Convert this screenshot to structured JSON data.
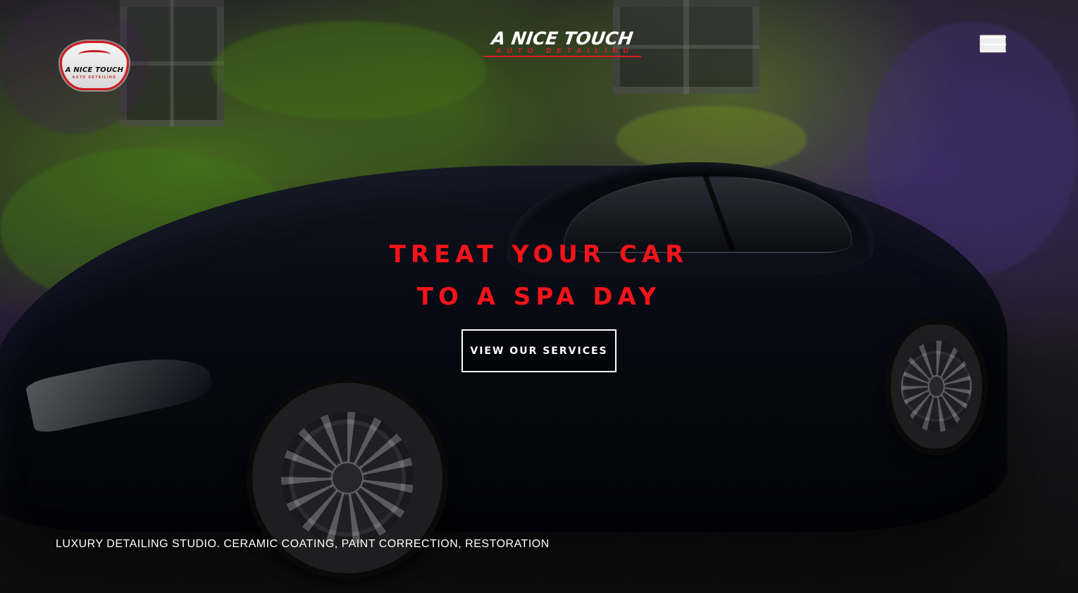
{
  "brand": {
    "logo_small_title": "A NICE TOUCH",
    "logo_small_subtitle": "AUTO DETAILING",
    "title": "A NICE TOUCH",
    "subtitle": "AUTO DETAILING"
  },
  "navigation": {
    "menu_icon": "hamburger-menu-icon"
  },
  "hero": {
    "headline_line_1": "TREAT YOUR CAR",
    "headline_line_2": "TO A SPA DAY",
    "cta_label": "VIEW OUR SERVICES",
    "tagline": "LUXURY DETAILING STUDIO. CERAMIC COATING, PAINT CORRECTION, RESTORATION"
  },
  "colors": {
    "accent_red": "#e21922",
    "text_white": "#ffffff"
  }
}
